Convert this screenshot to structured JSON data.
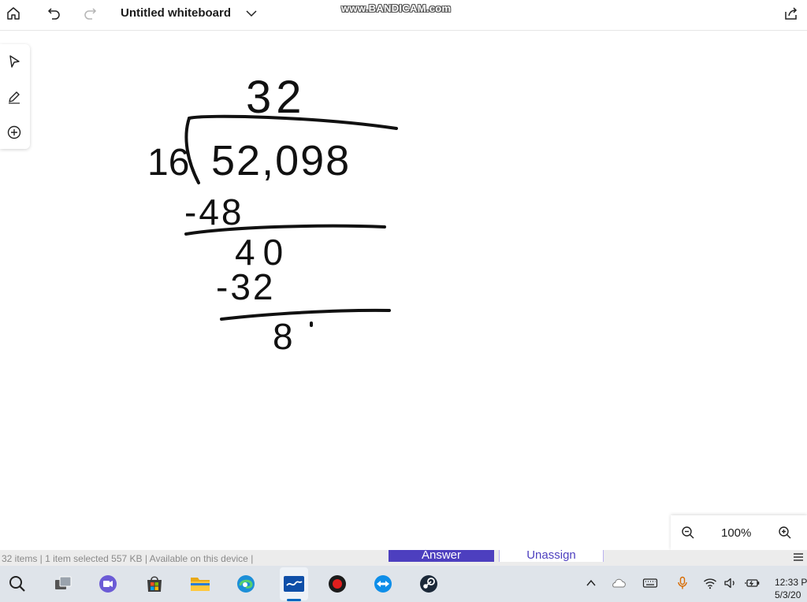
{
  "app": {
    "title": "Untitled whiteboard",
    "watermark": "www.BANDICAM.com"
  },
  "toolbar": {
    "icons": [
      "home-icon",
      "undo-icon",
      "redo-icon",
      "chevron-down-icon",
      "share-icon"
    ],
    "redo_enabled": false
  },
  "tools": {
    "items": [
      "select-tool-icon",
      "pen-tool-icon",
      "add-icon"
    ]
  },
  "whiteboard": {
    "quotient": "32",
    "divisor": "16",
    "dividend": "52,098",
    "step1": "-48",
    "remainder1": "40",
    "step2": "-32",
    "remainder2": "8",
    "ink_color": "#111111"
  },
  "zoom": {
    "value": "100%"
  },
  "background_strip": {
    "status": "32 items  |  1 item selected  557 KB  |  Available on this device  |",
    "answer_label": "Answer",
    "unassign_label": "Unassign",
    "accent": "#4d3fbf"
  },
  "taskbar": {
    "apps": [
      "search-icon",
      "task-view-icon",
      "chat-icon",
      "store-icon",
      "file-explorer-icon",
      "edge-icon",
      "whiteboard-icon",
      "bandicam-record-icon",
      "teamviewer-icon",
      "steam-icon"
    ],
    "tray": [
      "chevron-up-icon",
      "onedrive-icon",
      "keyboard-icon",
      "microphone-icon",
      "wifi-icon",
      "volume-icon",
      "battery-icon"
    ],
    "time": "12:33 P",
    "date": "5/3/20"
  }
}
